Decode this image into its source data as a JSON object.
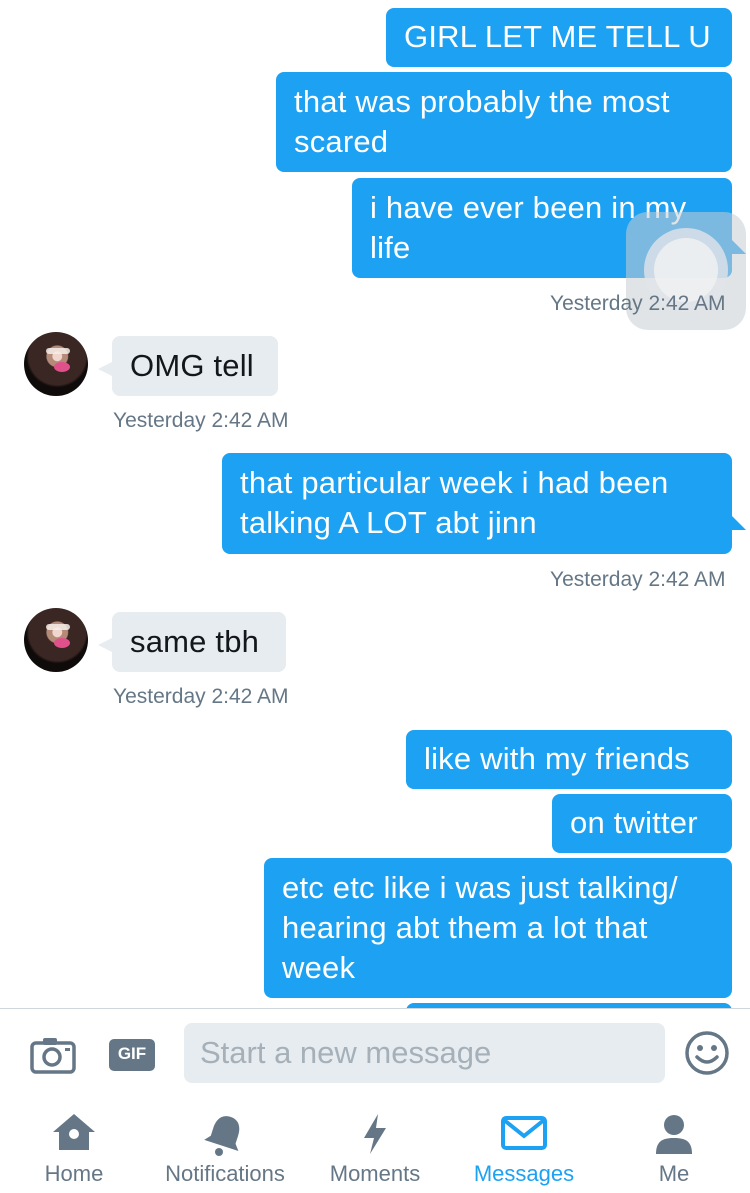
{
  "messages": {
    "m1": "GIRL LET ME TELL U",
    "m2_l1": "that was probably the most",
    "m2_l2": "scared",
    "m3_l1": "i have ever been in my",
    "m3_l2": "life",
    "ts1": "Yesterday 2:42 AM",
    "m4": "OMG tell",
    "ts2": "Yesterday 2:42 AM",
    "m5_l1": "that particular week i had been",
    "m5_l2": "talking A LOT abt jinn",
    "ts3": "Yesterday 2:42 AM",
    "m6": "same tbh",
    "ts4": "Yesterday 2:42 AM",
    "m7": "like with my friends",
    "m8": "on twitter",
    "m9_l1": "etc etc like i was just talking/",
    "m9_l2": "hearing abt them a lot that",
    "m9_l3": "week"
  },
  "composer": {
    "placeholder": "Start a new message",
    "gif_label": "GIF"
  },
  "tabs": {
    "home": "Home",
    "notifications": "Notifications",
    "moments": "Moments",
    "messages": "Messages",
    "me": "Me"
  },
  "colors": {
    "accent": "#1da1f2",
    "incoming_bubble": "#e6ecf0",
    "muted": "#657786"
  },
  "icons": {
    "camera": "camera-icon",
    "gif": "gif-icon",
    "emoji": "emoji-icon",
    "home": "home-icon",
    "notifications": "bell-icon",
    "moments": "lightning-icon",
    "messages": "envelope-icon",
    "me": "person-icon"
  }
}
